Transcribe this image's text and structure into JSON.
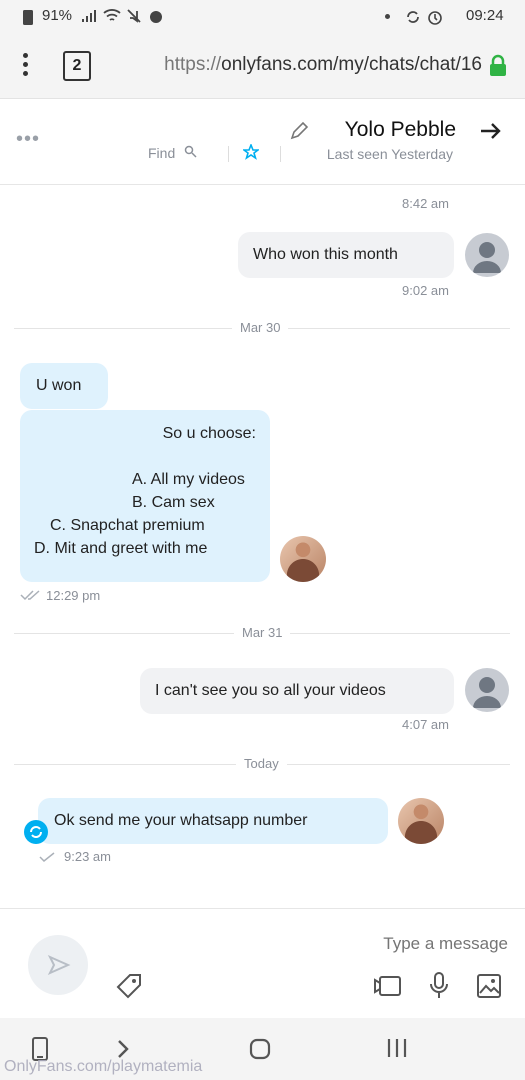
{
  "status_bar": {
    "time": "09:24",
    "battery": "91%"
  },
  "browser": {
    "tab_count": "2",
    "url_scheme": "https://",
    "url_rest": "onlyfans.com/my/chats/chat/16"
  },
  "chat_header": {
    "name": "Yolo Pebble",
    "last_seen": "Last seen Yesterday",
    "find_label": "Find"
  },
  "messages": {
    "top_time": "8:42 am",
    "msg1": {
      "text": "Who won this month",
      "time": "9:02 am"
    },
    "divider1": "Mar 30",
    "msg2": {
      "text": "U won"
    },
    "msg3": {
      "line1": "So u choose:",
      "options": [
        "A. All my videos",
        "B. Cam sex",
        "C. Snapchat premium",
        "D. Mit and greet with me"
      ],
      "time": "12:29 pm"
    },
    "divider2": "Mar 31",
    "msg4": {
      "text": "I can't see you so all your videos",
      "time": "4:07 am"
    },
    "divider3": "Today",
    "msg5": {
      "text": "Ok send me your whatsapp number",
      "time": "9:23 am"
    }
  },
  "input": {
    "placeholder": "Type a message"
  },
  "watermark": "OnlyFans.com/playmatemia",
  "colors": {
    "accent": "#00aff0",
    "lock": "#2fb344"
  }
}
